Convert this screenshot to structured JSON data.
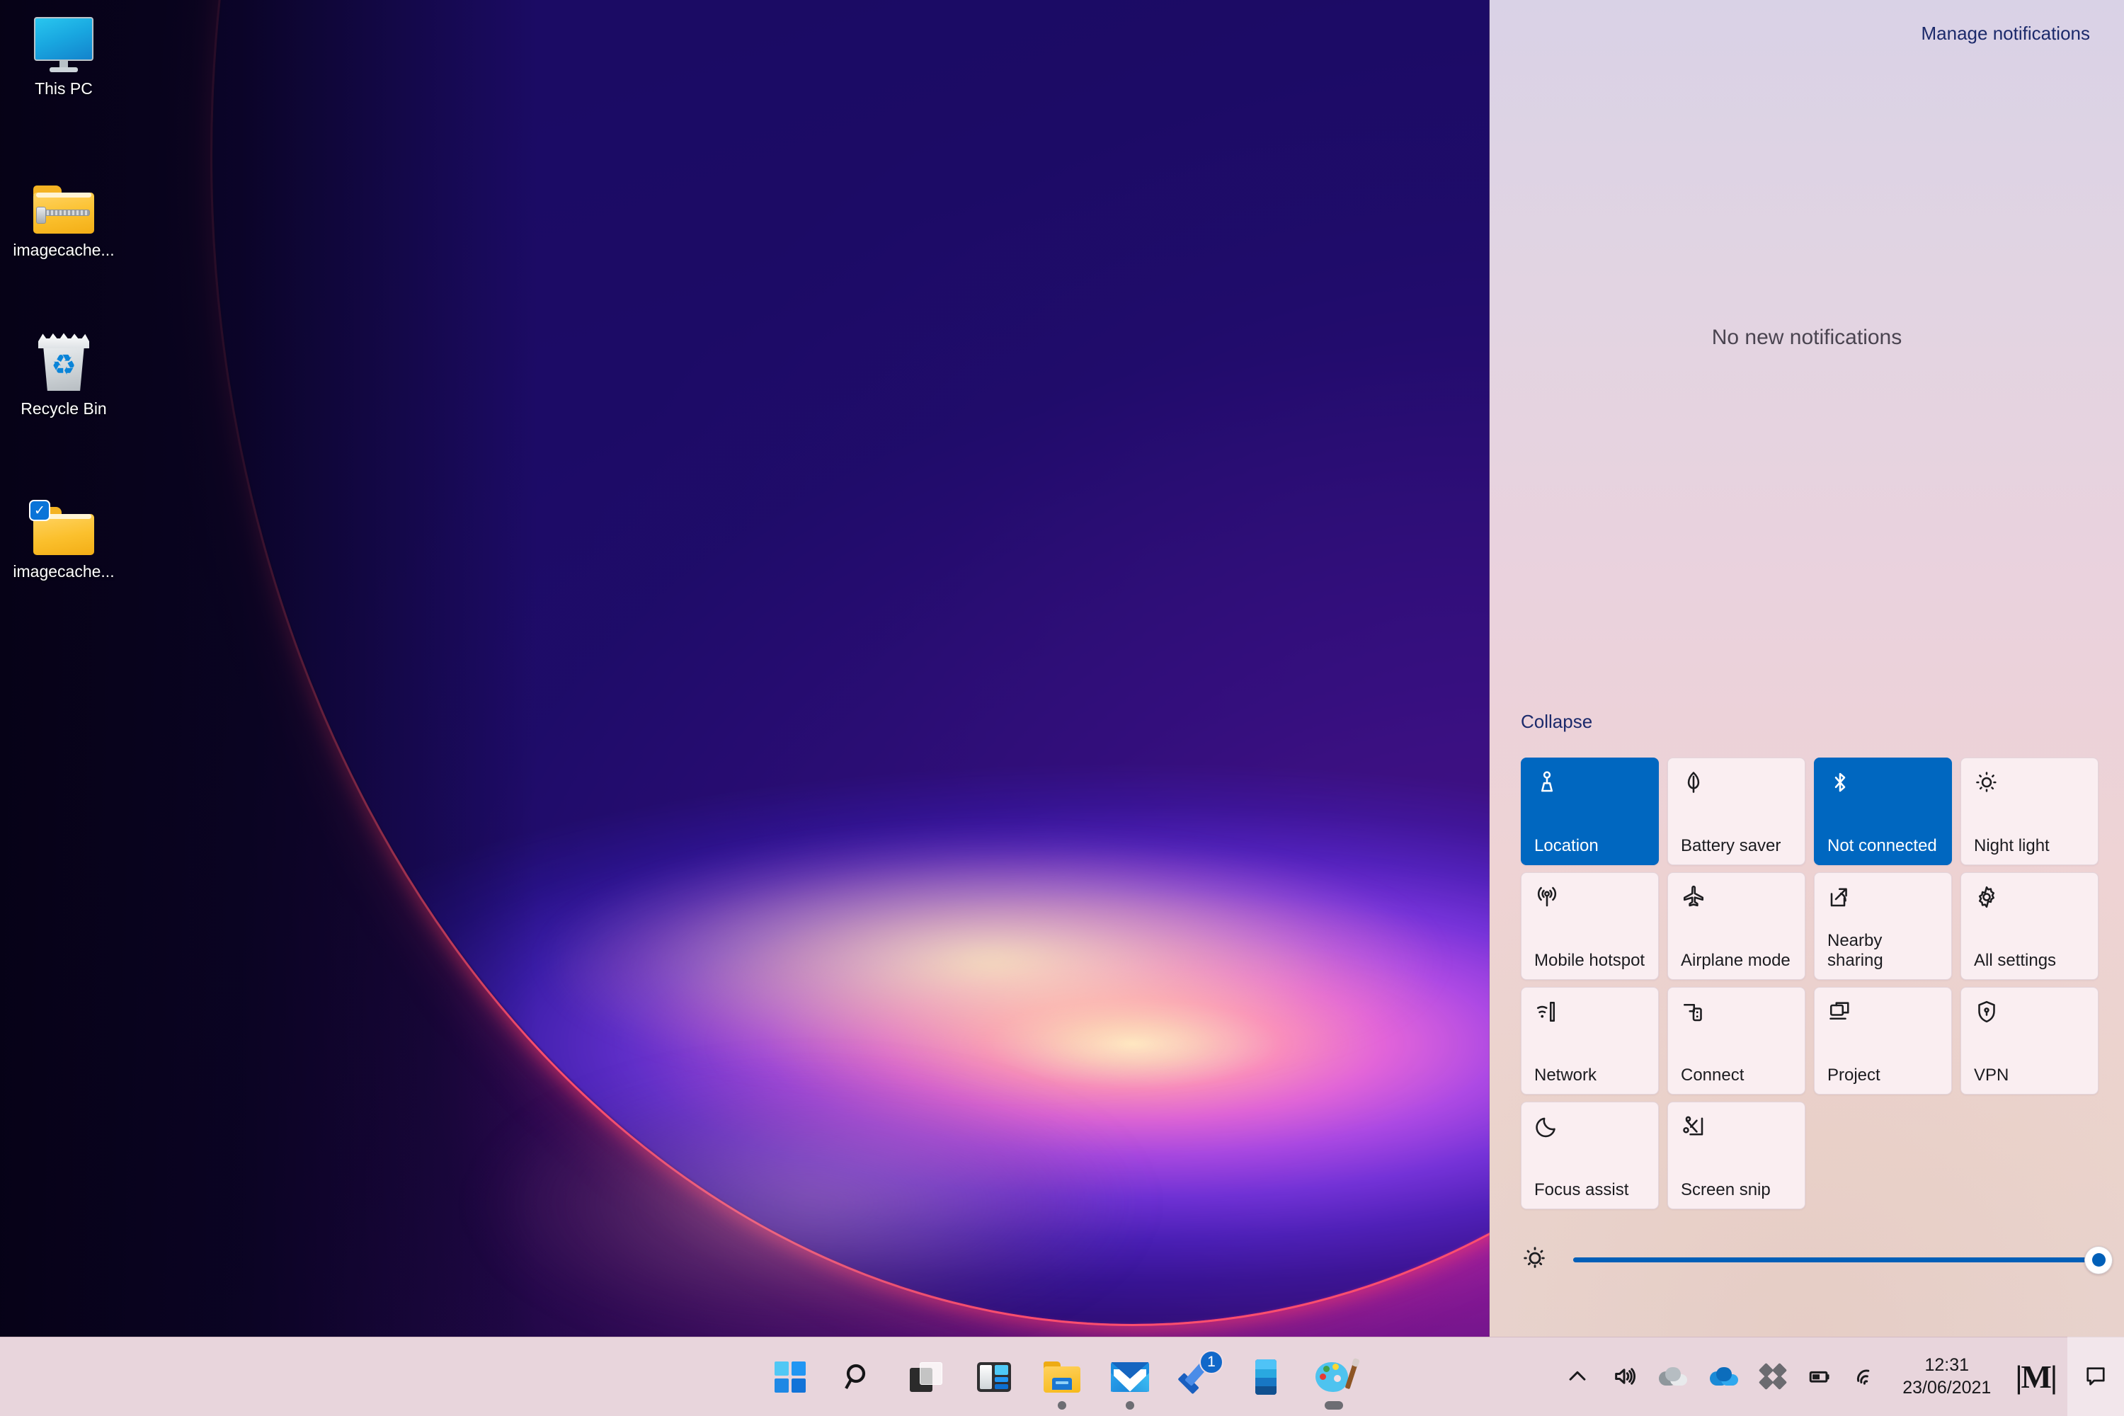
{
  "desktop": {
    "icons": [
      {
        "label": "This PC",
        "icon": "this-pc-icon"
      },
      {
        "label": "imagecache...",
        "icon": "zipped-folder-icon"
      },
      {
        "label": "Recycle Bin",
        "icon": "recycle-bin-icon"
      },
      {
        "label": "imagecache...",
        "icon": "folder-synced-icon"
      }
    ]
  },
  "action_center": {
    "manage_notifications": "Manage notifications",
    "empty_message": "No new notifications",
    "collapse_label": "Collapse",
    "accent_color": "#0067c0",
    "quick_actions": [
      {
        "label": "Location",
        "icon": "location-icon",
        "state": "on"
      },
      {
        "label": "Battery saver",
        "icon": "leaf-icon",
        "state": "off"
      },
      {
        "label": "Not connected",
        "icon": "bluetooth-icon",
        "state": "on"
      },
      {
        "label": "Night light",
        "icon": "sun-icon",
        "state": "off"
      },
      {
        "label": "Mobile hotspot",
        "icon": "hotspot-icon",
        "state": "off"
      },
      {
        "label": "Airplane mode",
        "icon": "airplane-icon",
        "state": "off"
      },
      {
        "label": "Nearby sharing",
        "icon": "share-icon",
        "state": "off"
      },
      {
        "label": "All settings",
        "icon": "gear-icon",
        "state": "off"
      },
      {
        "label": "Network",
        "icon": "network-icon",
        "state": "off"
      },
      {
        "label": "Connect",
        "icon": "connect-icon",
        "state": "off"
      },
      {
        "label": "Project",
        "icon": "project-icon",
        "state": "off"
      },
      {
        "label": "VPN",
        "icon": "vpn-shield-icon",
        "state": "off"
      },
      {
        "label": "Focus assist",
        "icon": "moon-icon",
        "state": "off"
      },
      {
        "label": "Screen snip",
        "icon": "snip-icon",
        "state": "off"
      }
    ],
    "brightness": {
      "icon": "brightness-icon",
      "value": 100
    }
  },
  "taskbar": {
    "apps": [
      {
        "name": "Start",
        "icon": "start-icon",
        "running": false,
        "badge": ""
      },
      {
        "name": "Search",
        "icon": "search-icon",
        "running": false,
        "badge": ""
      },
      {
        "name": "Task view",
        "icon": "task-view-icon",
        "running": false,
        "badge": ""
      },
      {
        "name": "Widgets",
        "icon": "widgets-icon",
        "running": false,
        "badge": ""
      },
      {
        "name": "File Explorer",
        "icon": "file-explorer-icon",
        "running": true,
        "badge": ""
      },
      {
        "name": "Mail",
        "icon": "mail-icon",
        "running": true,
        "badge": ""
      },
      {
        "name": "Microsoft To Do",
        "icon": "todo-icon",
        "running": false,
        "badge": "1"
      },
      {
        "name": "Your Phone",
        "icon": "phone-icon",
        "running": false,
        "badge": ""
      },
      {
        "name": "Paint",
        "icon": "paint-icon",
        "running": true,
        "badge": ""
      }
    ],
    "tray": [
      {
        "name": "Show hidden icons",
        "icon": "chevron-up-icon"
      },
      {
        "name": "Volume",
        "icon": "speaker-icon"
      },
      {
        "name": "OneDrive (work)",
        "icon": "onedrive-gray-icon"
      },
      {
        "name": "OneDrive (personal)",
        "icon": "onedrive-blue-icon"
      },
      {
        "name": "Dropbox",
        "icon": "dropbox-icon"
      },
      {
        "name": "Battery",
        "icon": "battery-icon"
      },
      {
        "name": "Network",
        "icon": "wifi-icon"
      }
    ],
    "clock": {
      "time": "12:31",
      "date": "23/06/2021"
    },
    "mathtype": {
      "label": "MathType",
      "icon": "mathtype-icon"
    },
    "notification_button": {
      "name": "Notifications",
      "icon": "notification-icon"
    }
  }
}
